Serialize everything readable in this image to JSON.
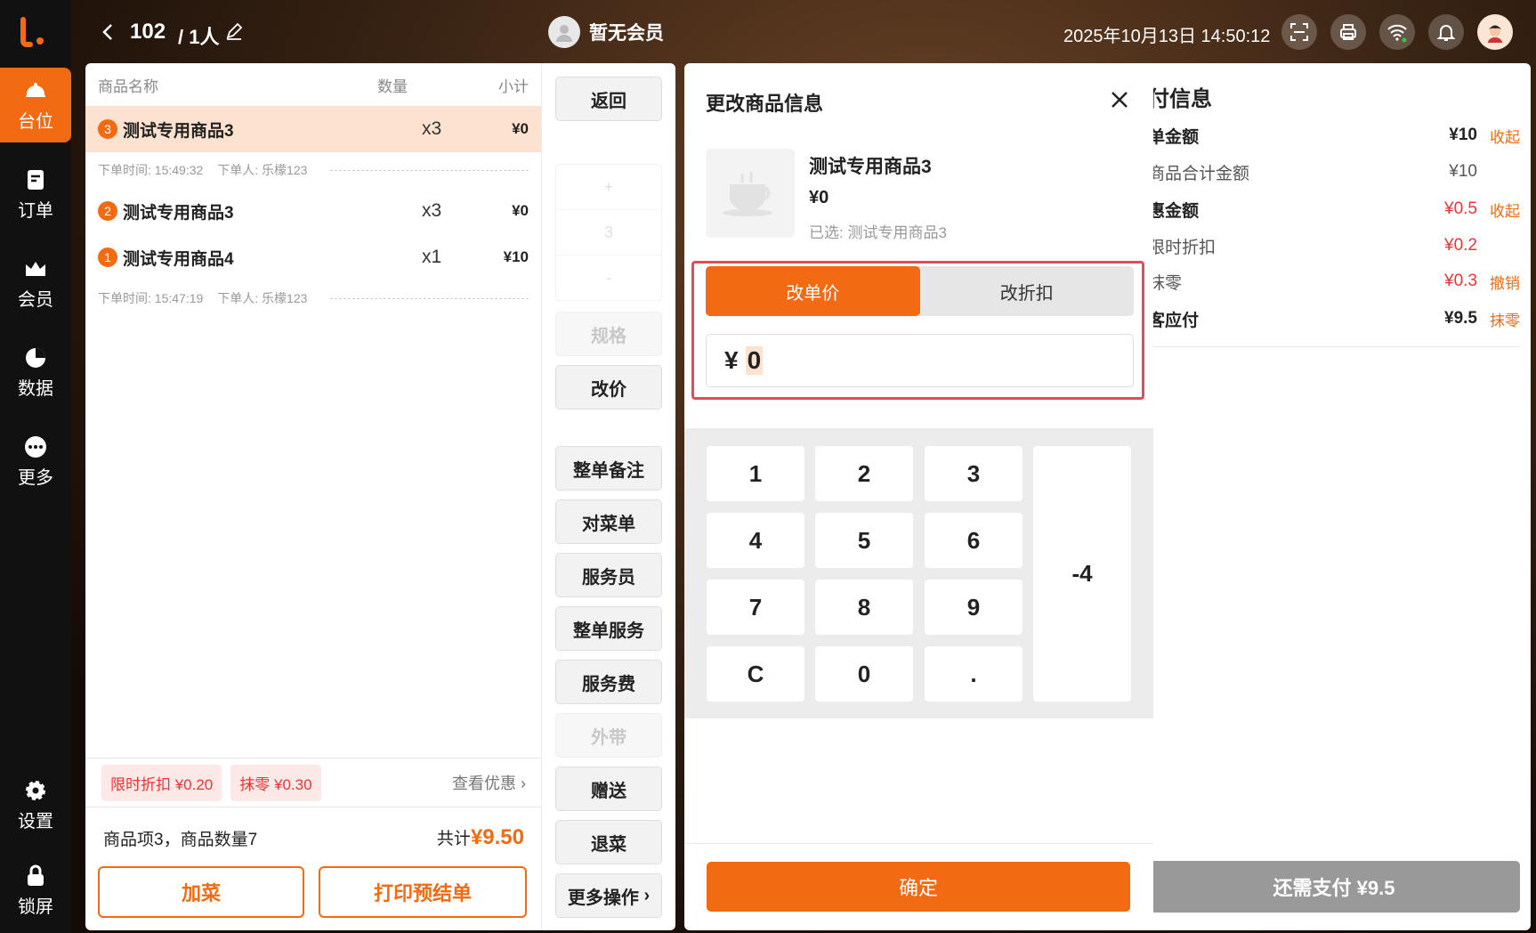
{
  "nav": {
    "items": [
      {
        "label": "台位"
      },
      {
        "label": "订单"
      },
      {
        "label": "会员"
      },
      {
        "label": "数据"
      },
      {
        "label": "更多"
      },
      {
        "label": "设置"
      },
      {
        "label": "锁屏"
      }
    ]
  },
  "header": {
    "table_no": "102",
    "persons": "/ 1人",
    "member": "暂无会员",
    "datetime": "2025年10月13日 14:50:12"
  },
  "order": {
    "columns": {
      "name": "商品名称",
      "qty": "数量",
      "subtotal": "小计"
    },
    "items": [
      {
        "badge": "3",
        "name": "测试专用商品3",
        "qty": "x3",
        "subtotal": "¥0"
      },
      {
        "badge": "2",
        "name": "测试专用商品3",
        "qty": "x3",
        "subtotal": "¥0"
      },
      {
        "badge": "1",
        "name": "测试专用商品4",
        "qty": "x1",
        "subtotal": "¥10"
      }
    ],
    "metas": [
      {
        "time": "下单时间: 15:49:32",
        "user": "下单人: 乐檬123"
      },
      {
        "time": "下单时间: 15:47:19",
        "user": "下单人: 乐檬123"
      }
    ],
    "promo": {
      "tag1": "限时折扣 ¥0.20",
      "tag2": "抹零 ¥0.30",
      "more": "查看优惠"
    },
    "summary": {
      "count": "商品项3，商品数量7",
      "total_label": "共计",
      "total": "¥9.50"
    },
    "add_btn": "加菜",
    "print_btn": "打印预结单"
  },
  "actions": {
    "back": "返回",
    "stepper": [
      "+",
      "3",
      "-"
    ],
    "spec": "规格",
    "reprice": "改价",
    "note": "整单备注",
    "check": "对菜单",
    "waiter": "服务员",
    "service": "整单服务",
    "fee": "服务费",
    "takeout": "外带",
    "gift": "赠送",
    "refund": "退菜",
    "more": "更多操作"
  },
  "pay": {
    "title": "付信息",
    "rows": [
      {
        "label": "单金额",
        "value": "¥10",
        "action": "收起"
      },
      {
        "label": "商品合计金额",
        "value": "¥10",
        "action": ""
      },
      {
        "label": "惠金额",
        "value": "¥0.5",
        "action": "收起"
      },
      {
        "label": "限时折扣",
        "value": "¥0.2",
        "action": ""
      },
      {
        "label": "抹零",
        "value": "¥0.3",
        "action": "撤销"
      },
      {
        "label": "客应付",
        "value": "¥9.5",
        "action": "抹零"
      }
    ],
    "button": "还需支付 ¥9.5"
  },
  "modal": {
    "title": "更改商品信息",
    "product": {
      "name": "测试专用商品3",
      "price": "¥0",
      "selected": "已选: 测试专用商品3"
    },
    "tabs": {
      "price": "改单价",
      "discount": "改折扣"
    },
    "currency": "¥",
    "input_value": "0",
    "keys": [
      "1",
      "2",
      "3",
      "4",
      "5",
      "6",
      "7",
      "8",
      "9",
      "C",
      "0",
      "."
    ],
    "minus_key": "-4",
    "confirm": "确定"
  },
  "colors": {
    "accent": "#f26a12",
    "highlight": "#e54b57"
  }
}
